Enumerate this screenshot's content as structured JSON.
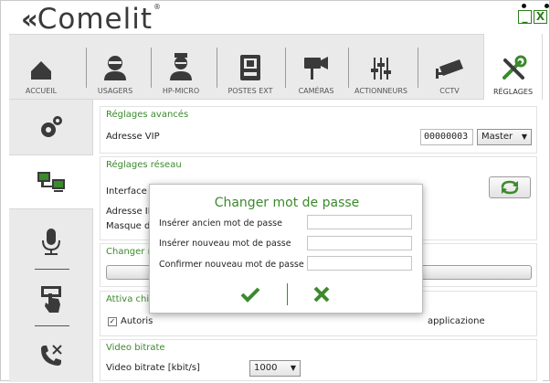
{
  "app": {
    "logo": "Comelit",
    "registered": "®"
  },
  "window": {
    "minimize": "_",
    "close": "X"
  },
  "nav": {
    "items": [
      {
        "label": "ACCUEIL",
        "icon": "home-icon"
      },
      {
        "label": "USAGERS",
        "icon": "user-icon"
      },
      {
        "label": "HP-MICRO",
        "icon": "operator-icon"
      },
      {
        "label": "POSTES EXT",
        "icon": "door-station-icon"
      },
      {
        "label": "CAMÉRAS",
        "icon": "camera-icon"
      },
      {
        "label": "ACTIONNEURS",
        "icon": "actuator-icon"
      },
      {
        "label": "CCTV",
        "icon": "cctv-icon"
      },
      {
        "label": "RÉGLAGES",
        "icon": "tools-icon",
        "active": true
      }
    ]
  },
  "sidebar": {
    "items": [
      {
        "icon": "gears-icon"
      },
      {
        "icon": "network-icon",
        "active": true
      },
      {
        "icon": "microphone-icon"
      },
      {
        "icon": "touch-icon"
      },
      {
        "icon": "phone-settings-icon"
      }
    ]
  },
  "advanced": {
    "title": "Réglages avancés",
    "vip_label": "Adresse VIP",
    "vip_value": "00000003",
    "role_value": "Master"
  },
  "network": {
    "title": "Réglages réseau",
    "interface_label": "Interface r",
    "ip_label": "Adresse IP",
    "mask_label": "Masque de"
  },
  "change": {
    "title": "Changer m"
  },
  "attiva": {
    "title": "Attiva chiu",
    "check_label": "Autoris",
    "app_text": "applicazione",
    "checked": true
  },
  "video": {
    "title": "Video bitrate",
    "label": "Video bitrate [kbit/s]",
    "value": "1000"
  },
  "dialog": {
    "title": "Changer mot de passe",
    "old_label": "Insérer ancien mot de passe",
    "new_label": "Insérer nouveau mot de passe",
    "confirm_label": "Confirmer nouveau mot de passe",
    "ok_icon": "check-icon",
    "cancel_icon": "x-icon"
  },
  "colors": {
    "accent": "#3b8a2c",
    "dark": "#3a3a3a"
  }
}
